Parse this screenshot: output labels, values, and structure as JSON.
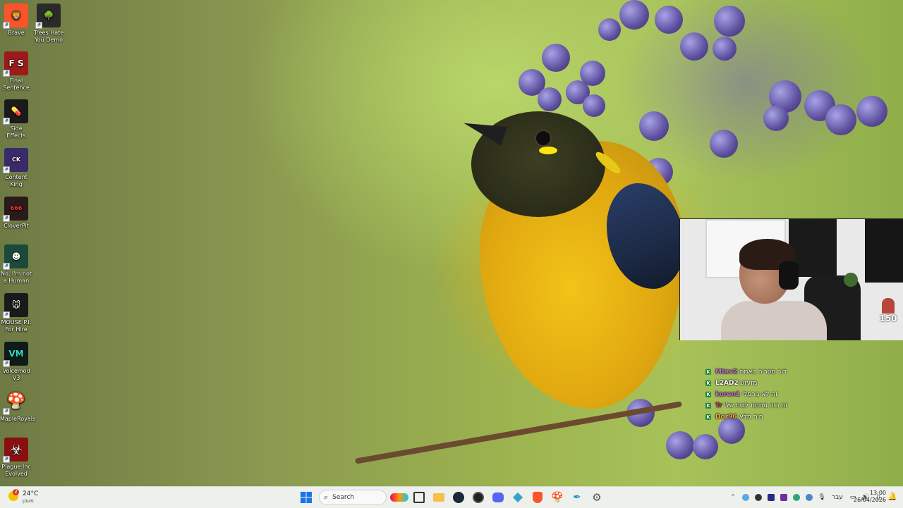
{
  "desktop": {
    "icons": [
      {
        "label": "Brave",
        "icon": "brave-lion-icon",
        "color": "#fb542b"
      },
      {
        "label": "Trees Hate You Demo",
        "icon": "tree-icon",
        "color": "#2a2a2a"
      },
      {
        "label": "Final Sentence",
        "icon": "final-sentence-icon",
        "color": "#9c1a1a"
      },
      {
        "label": "Side Effects",
        "icon": "side-effects-icon",
        "color": "#1a1a1a"
      },
      {
        "label": "Content King",
        "icon": "content-king-icon",
        "color": "#3a2a6a"
      },
      {
        "label": "CloverPit",
        "icon": "cloverpit-icon",
        "color": "#2a1a1a"
      },
      {
        "label": "No, I'm not a Human",
        "icon": "not-human-icon",
        "color": "#1c4a3a"
      },
      {
        "label": "MOUSE P.I. For Hire",
        "icon": "mouse-pi-icon",
        "color": "#1a1a1a"
      },
      {
        "label": "Voicemod V3",
        "icon": "voicemod-icon",
        "color": "#0f1a1a"
      },
      {
        "label": "MapleRoyals",
        "icon": "mushroom-icon",
        "color": "#e86a1a"
      },
      {
        "label": "Plague Inc Evolved",
        "icon": "biohazard-icon",
        "color": "#8a1010"
      }
    ]
  },
  "stream": {
    "badge_count": "150",
    "chat": [
      {
        "user": "Mtav2",
        "text": "דור מסריח באמת",
        "user_color": "#c46bd6"
      },
      {
        "user": "L2AD2",
        "text": "מזעזע",
        "user_color": "#ffffff"
      },
      {
        "user": "koren1",
        "text": "זה לא נורמלי",
        "user_color": "#c46bd6"
      },
      {
        "user": "Tr",
        "text": "זה היה מחתח לבית שלי",
        "user_color": "#d6336b"
      },
      {
        "user": "Dor96",
        "text": "היה מלא",
        "user_color": "#f2a654"
      }
    ]
  },
  "taskbar": {
    "weather_temp": "24°C",
    "weather_cond": "מעונן",
    "weather_badge": "2",
    "search_label": "Search",
    "lang": "עבר",
    "time": "13:00",
    "date": "26/04/2026"
  }
}
